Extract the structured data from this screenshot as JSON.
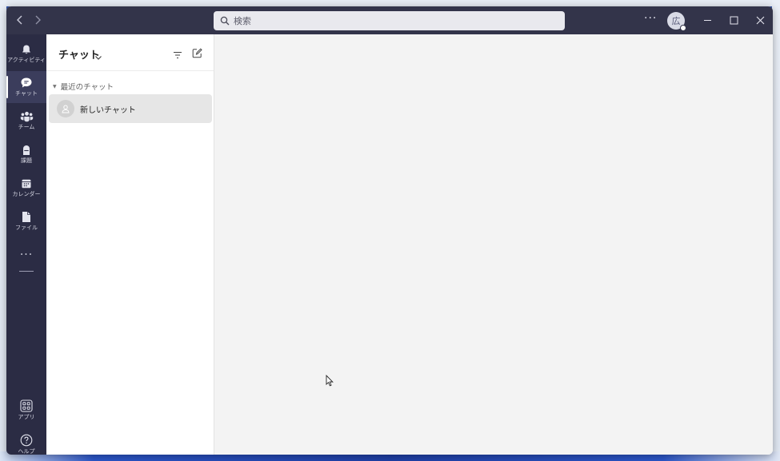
{
  "titlebar": {
    "search_placeholder": "検索",
    "more_label": "···",
    "avatar_initial": "広"
  },
  "rail": {
    "items": [
      {
        "label": "アクティビティ",
        "icon": "bell-icon"
      },
      {
        "label": "チャット",
        "icon": "chat-icon"
      },
      {
        "label": "チーム",
        "icon": "teams-icon"
      },
      {
        "label": "課題",
        "icon": "assignment-icon"
      },
      {
        "label": "カレンダー",
        "icon": "calendar-icon"
      },
      {
        "label": "ファイル",
        "icon": "file-icon"
      },
      {
        "label": "アプリ",
        "icon": "apps-icon"
      },
      {
        "label": "ヘルプ",
        "icon": "help-icon"
      }
    ],
    "more_label": "···"
  },
  "chat_panel": {
    "title": "チャット",
    "section_label": "最近のチャット",
    "items": [
      {
        "name": "新しいチャット"
      }
    ]
  },
  "colors": {
    "titlebar": "#33344a",
    "rail": "#2b2c44",
    "panel": "#ffffff",
    "main": "#f3f3f3"
  }
}
